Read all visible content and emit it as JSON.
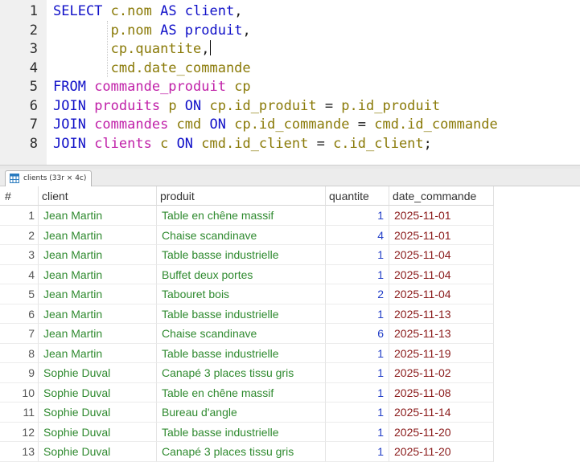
{
  "editor": {
    "lines": [
      {
        "num": "1",
        "tokens": [
          {
            "t": "SELECT ",
            "c": "kw"
          },
          {
            "t": "c.nom ",
            "c": "fld"
          },
          {
            "t": "AS ",
            "c": "kw"
          },
          {
            "t": "client",
            "c": "kw"
          },
          {
            "t": ",",
            "c": "plain"
          }
        ]
      },
      {
        "num": "2",
        "tokens": [
          {
            "t": "       ",
            "c": "plain"
          },
          {
            "t": "p.nom ",
            "c": "fld"
          },
          {
            "t": "AS ",
            "c": "kw"
          },
          {
            "t": "produit",
            "c": "kw"
          },
          {
            "t": ",",
            "c": "plain"
          }
        ]
      },
      {
        "num": "3",
        "tokens": [
          {
            "t": "       ",
            "c": "plain"
          },
          {
            "t": "cp.quantite",
            "c": "fld"
          },
          {
            "t": ",",
            "c": "plain"
          }
        ],
        "caret": true
      },
      {
        "num": "4",
        "tokens": [
          {
            "t": "       ",
            "c": "plain"
          },
          {
            "t": "cmd.date_commande",
            "c": "fld"
          }
        ]
      },
      {
        "num": "5",
        "tokens": [
          {
            "t": "FROM ",
            "c": "kw"
          },
          {
            "t": "commande_produit ",
            "c": "tbl"
          },
          {
            "t": "cp",
            "c": "fld"
          }
        ]
      },
      {
        "num": "6",
        "tokens": [
          {
            "t": "JOIN ",
            "c": "kw"
          },
          {
            "t": "produits ",
            "c": "tbl"
          },
          {
            "t": "p ",
            "c": "fld"
          },
          {
            "t": "ON ",
            "c": "kw"
          },
          {
            "t": "cp.id_produit ",
            "c": "fld"
          },
          {
            "t": "= ",
            "c": "plain"
          },
          {
            "t": "p.id_produit",
            "c": "fld"
          }
        ]
      },
      {
        "num": "7",
        "tokens": [
          {
            "t": "JOIN ",
            "c": "kw"
          },
          {
            "t": "commandes ",
            "c": "tbl"
          },
          {
            "t": "cmd ",
            "c": "fld"
          },
          {
            "t": "ON ",
            "c": "kw"
          },
          {
            "t": "cp.id_commande ",
            "c": "fld"
          },
          {
            "t": "= ",
            "c": "plain"
          },
          {
            "t": "cmd.id_commande",
            "c": "fld"
          }
        ]
      },
      {
        "num": "8",
        "tokens": [
          {
            "t": "JOIN ",
            "c": "kw"
          },
          {
            "t": "clients ",
            "c": "tbl"
          },
          {
            "t": "c ",
            "c": "fld"
          },
          {
            "t": "ON ",
            "c": "kw"
          },
          {
            "t": "cmd.id_client ",
            "c": "fld"
          },
          {
            "t": "= ",
            "c": "plain"
          },
          {
            "t": "c.id_client",
            "c": "fld"
          },
          {
            "t": ";",
            "c": "plain"
          }
        ]
      }
    ]
  },
  "result_tab": {
    "label": "clients (33r × 4c)",
    "icon": "table-grid-icon"
  },
  "grid": {
    "columns": [
      "#",
      "client",
      "produit",
      "quantite",
      "date_commande"
    ],
    "rows": [
      [
        "1",
        "Jean Martin",
        "Table en chêne massif",
        "1",
        "2025-11-01"
      ],
      [
        "2",
        "Jean Martin",
        "Chaise scandinave",
        "4",
        "2025-11-01"
      ],
      [
        "3",
        "Jean Martin",
        "Table basse industrielle",
        "1",
        "2025-11-04"
      ],
      [
        "4",
        "Jean Martin",
        "Buffet deux portes",
        "1",
        "2025-11-04"
      ],
      [
        "5",
        "Jean Martin",
        "Tabouret bois",
        "2",
        "2025-11-04"
      ],
      [
        "6",
        "Jean Martin",
        "Table basse industrielle",
        "1",
        "2025-11-13"
      ],
      [
        "7",
        "Jean Martin",
        "Chaise scandinave",
        "6",
        "2025-11-13"
      ],
      [
        "8",
        "Jean Martin",
        "Table basse industrielle",
        "1",
        "2025-11-19"
      ],
      [
        "9",
        "Sophie Duval",
        "Canapé 3 places tissu gris",
        "1",
        "2025-11-02"
      ],
      [
        "10",
        "Sophie Duval",
        "Table en chêne massif",
        "1",
        "2025-11-08"
      ],
      [
        "11",
        "Sophie Duval",
        "Bureau d'angle",
        "1",
        "2025-11-14"
      ],
      [
        "12",
        "Sophie Duval",
        "Table basse industrielle",
        "1",
        "2025-11-20"
      ],
      [
        "13",
        "Sophie Duval",
        "Canapé 3 places tissu gris",
        "1",
        "2025-11-20"
      ]
    ]
  },
  "colors": {
    "keyword": "#1010c8",
    "table_name": "#c020a8",
    "field": "#8a7a08",
    "text_value": "#2f8a2f",
    "number_value": "#2440c8",
    "date_value": "#8a1a1a"
  }
}
